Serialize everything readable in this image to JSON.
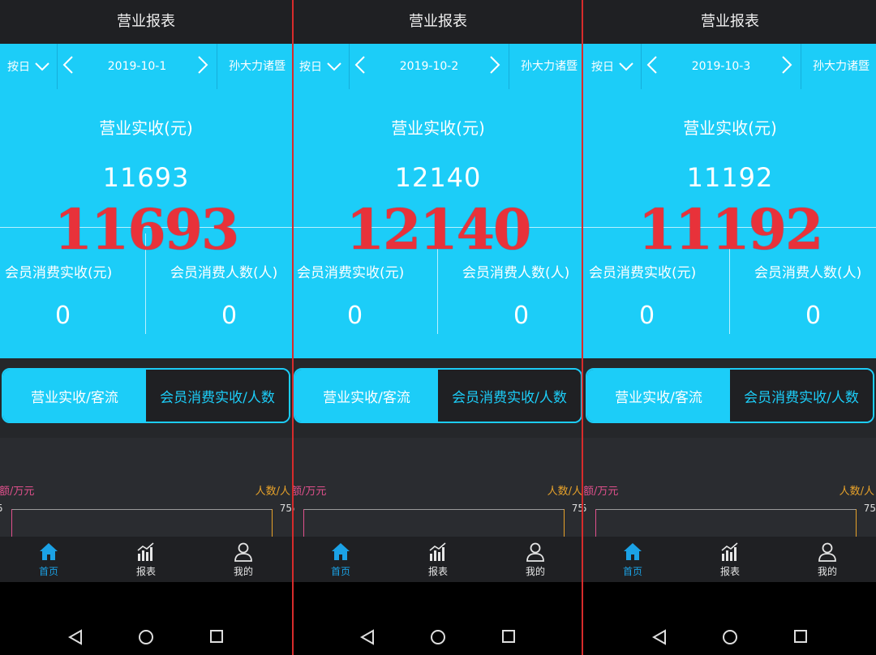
{
  "screens": [
    {
      "title": "营业报表",
      "mode": "按日",
      "date": "2019-10-1",
      "store": "孙大力诸暨",
      "revenue_label": "营业实收(元)",
      "revenue_value": "11693",
      "revenue_overlay": "11693",
      "member_revenue_label": "会员消费实收(元)",
      "member_revenue_value": "0",
      "member_count_label": "会员消费人数(人)",
      "member_count_value": "0",
      "toggle": [
        "营业实收/客流",
        "会员消费实收/人数"
      ],
      "chart_left_unit": "额/万元",
      "chart_right_unit": "人数/人",
      "chart_left_tick": "5",
      "chart_right_tick": "75",
      "tabs": [
        "首页",
        "报表",
        "我的"
      ]
    },
    {
      "title": "营业报表",
      "mode": "按日",
      "date": "2019-10-2",
      "store": "孙大力诸暨",
      "revenue_label": "营业实收(元)",
      "revenue_value": "12140",
      "revenue_overlay": "12140",
      "member_revenue_label": "会员消费实收(元)",
      "member_revenue_value": "0",
      "member_count_label": "会员消费人数(人)",
      "member_count_value": "0",
      "toggle": [
        "营业实收/客流",
        "会员消费实收/人数"
      ],
      "chart_left_unit": "额/万元",
      "chart_right_unit": "人数/人",
      "chart_left_tick": "5",
      "chart_right_tick": "75",
      "tabs": [
        "首页",
        "报表",
        "我的"
      ]
    },
    {
      "title": "营业报表",
      "mode": "按日",
      "date": "2019-10-3",
      "store": "孙大力诸暨",
      "revenue_label": "营业实收(元)",
      "revenue_value": "11192",
      "revenue_overlay": "11192",
      "member_revenue_label": "会员消费实收(元)",
      "member_revenue_value": "0",
      "member_count_label": "会员消费人数(人)",
      "member_count_value": "0",
      "toggle": [
        "营业实收/客流",
        "会员消费实收/人数"
      ],
      "chart_left_unit": "额/万元",
      "chart_right_unit": "人数/人",
      "chart_left_tick": "5",
      "chart_right_tick": "75",
      "tabs": [
        "首页",
        "报表",
        "我的"
      ]
    }
  ],
  "colors": {
    "accent": "#1ccdf8",
    "overlay_red": "#e8323a",
    "tab_active": "#1ba2e6"
  }
}
